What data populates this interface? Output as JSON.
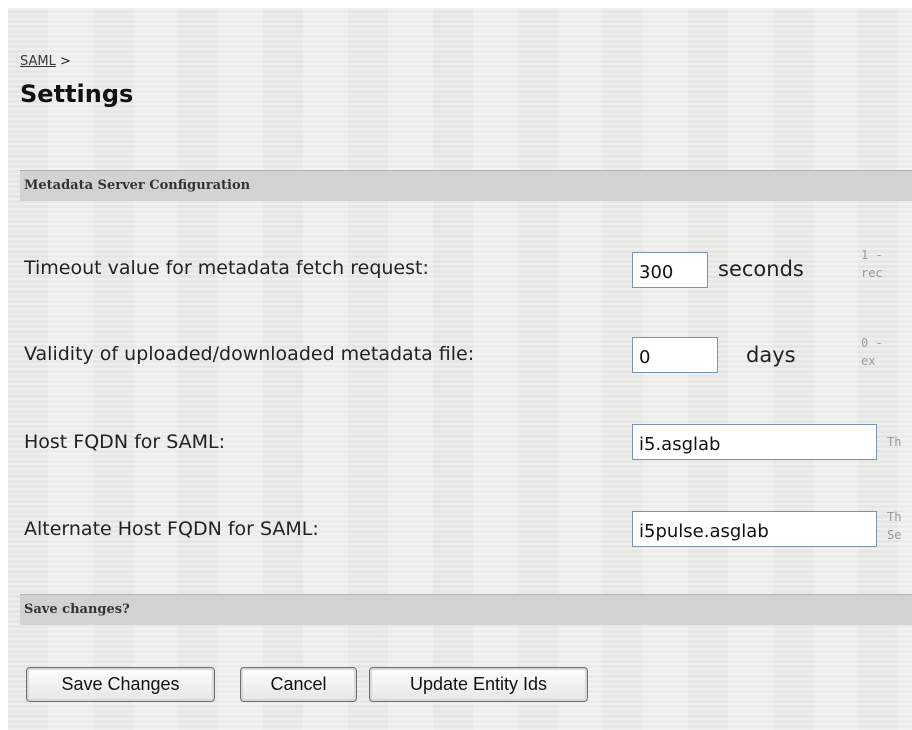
{
  "breadcrumb": {
    "link": "SAML",
    "separator": ">"
  },
  "page_title": "Settings",
  "sections": {
    "metadata": "Metadata Server Configuration",
    "save": "Save changes?"
  },
  "fields": {
    "timeout": {
      "label": "Timeout value for metadata fetch request:",
      "value": "300",
      "unit": "seconds",
      "help_line1": "1 -",
      "help_line2": "rec"
    },
    "validity": {
      "label": "Validity of uploaded/downloaded metadata file:",
      "value": "0",
      "unit": "days",
      "help_line1": "0 -",
      "help_line2": "ex"
    },
    "host_fqdn": {
      "label": "Host FQDN for SAML:",
      "value": "i5.asglab",
      "help_line1": "Th"
    },
    "alt_host_fqdn": {
      "label": "Alternate Host FQDN for SAML:",
      "value": "i5pulse.asglab",
      "help_line1": "Th",
      "help_line2": "Se"
    }
  },
  "buttons": {
    "save": "Save Changes",
    "cancel": "Cancel",
    "update": "Update Entity Ids"
  },
  "colors": {
    "page_background": "#ebebe8",
    "section_bar": "#d2d2cf",
    "input_border": "#7a93b8"
  }
}
